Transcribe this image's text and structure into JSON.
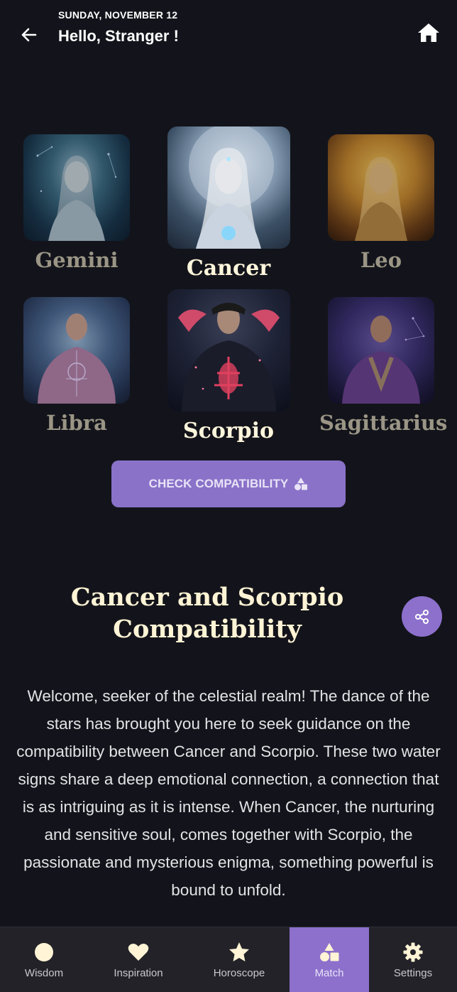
{
  "header": {
    "date": "SUNDAY, NOVEMBER 12",
    "greeting": "Hello, Stranger !",
    "back_icon": "arrow-left-icon",
    "home_icon": "home-icon"
  },
  "signs": [
    {
      "name": "Gemini",
      "selected": false
    },
    {
      "name": "Cancer",
      "selected": true
    },
    {
      "name": "Leo",
      "selected": false
    },
    {
      "name": "Libra",
      "selected": false
    },
    {
      "name": "Scorpio",
      "selected": true
    },
    {
      "name": "Sagittarius",
      "selected": false
    }
  ],
  "check_button": {
    "label": "CHECK COMPATIBILITY",
    "icon": "shapes-icon"
  },
  "compatibility": {
    "title": "Cancer and Scorpio Compatibility",
    "share_icon": "share-icon",
    "body": "Welcome, seeker of the celestial realm! The dance of the stars has brought you here to seek guidance on the compatibility between Cancer and Scorpio. These two water signs share a deep emotional connection, a connection that is as intriguing as it is intense. When Cancer, the nurturing and sensitive soul, comes together with Scorpio, the passionate and mysterious enigma, something powerful is bound to unfold."
  },
  "bottom_nav": {
    "items": [
      {
        "label": "Wisdom",
        "icon": "moon-circle-icon",
        "active": false
      },
      {
        "label": "Inspiration",
        "icon": "heart-icon",
        "active": false
      },
      {
        "label": "Horoscope",
        "icon": "star-icon",
        "active": false
      },
      {
        "label": "Match",
        "icon": "shapes-icon",
        "active": true
      },
      {
        "label": "Settings",
        "icon": "gear-icon",
        "active": false
      }
    ]
  },
  "colors": {
    "background": "#13141b",
    "accent": "#8c70cc",
    "title": "#fff4d5",
    "nav_background": "#222228"
  }
}
